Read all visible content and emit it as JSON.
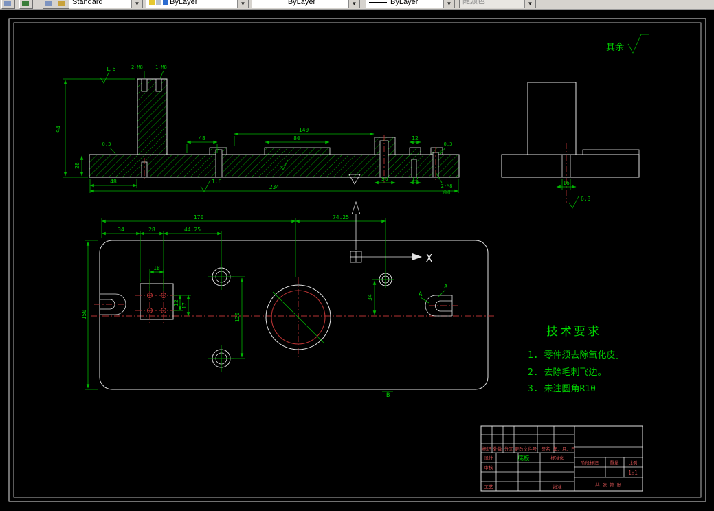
{
  "toolbar": {
    "style": "Standard",
    "layer": "ByLayer",
    "color": "ByLayer",
    "linetype": "ByLayer",
    "plot_style": "随颜色"
  },
  "notes": {
    "rest_label": "其余",
    "axis_x": "X",
    "tech_title": "技术要求",
    "tech_items": [
      "1. 零件须去除氧化皮。",
      "2. 去除毛刺飞边。",
      "3. 未注圆角R10"
    ]
  },
  "dims": {
    "sec": [
      "1.6",
      "2-M8",
      "1-M8",
      "94",
      "28",
      "48",
      "80",
      "140",
      "12",
      "48",
      "1.6",
      "234",
      "50",
      "12",
      "2-M8",
      "通孔",
      "0.3",
      "0.3"
    ],
    "side": [
      "16",
      "6.3"
    ],
    "plan": [
      "170",
      "74.25",
      "34",
      "28",
      "44.25",
      "150",
      "120",
      "34",
      "18",
      "12",
      "17",
      "A",
      "A",
      "B"
    ]
  },
  "titleblock": {
    "rev": [
      "标记",
      "处数",
      "分区",
      "更改文件号",
      "签名",
      "年、月、日"
    ],
    "design": "设计",
    "check": "审核",
    "process": "工艺",
    "approve": "批准",
    "standardize": "标准化",
    "part_name": "底板",
    "stage": "阶段标记",
    "weight": "重量",
    "scale": "比例",
    "scale_value": "1:1",
    "sheet_info": "共 张 第 张"
  }
}
